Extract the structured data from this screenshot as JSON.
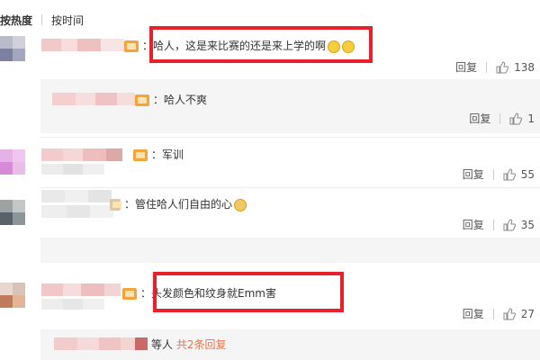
{
  "sort_tabs": [
    {
      "label": "按热度",
      "active": true
    },
    {
      "label": "按时间",
      "active": false
    }
  ],
  "comments": [
    {
      "text": "：哈人，这是来比赛的还是来上学的啊",
      "reply_label": "回复",
      "likes": "138"
    },
    {
      "text": "：哈人不爽",
      "reply_label": "回复",
      "likes": "1"
    },
    {
      "text": "：军训",
      "reply_label": "回复",
      "likes": "55"
    },
    {
      "text": "：管住哈人们自由的心",
      "reply_label": "回复",
      "likes": "35"
    },
    {
      "text": "：头发颜色和纹身就Emm害",
      "reply_label": "回复",
      "likes": "27"
    }
  ],
  "sub_replies": {
    "etc_text": "等人",
    "more_link": "共2条回复"
  },
  "colors": {
    "highlight": "#e8202a",
    "badge": "#f4a43a",
    "link": "#eb7350",
    "reply_bg": "#f5f5f5"
  },
  "icons": [
    "thumbs-up-icon",
    "fan-badge-icon",
    "laugh-emoji-icon",
    "cat-emoji-icon"
  ]
}
